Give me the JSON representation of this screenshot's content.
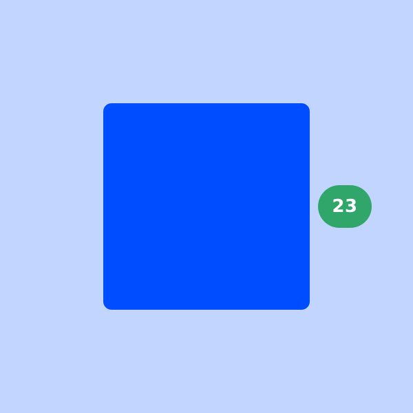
{
  "colors": {
    "background": "#c2d5ff",
    "square": "#004dff",
    "badge_background": "#31a66b",
    "badge_text": "#ffffff"
  },
  "badge": {
    "count": "23"
  }
}
